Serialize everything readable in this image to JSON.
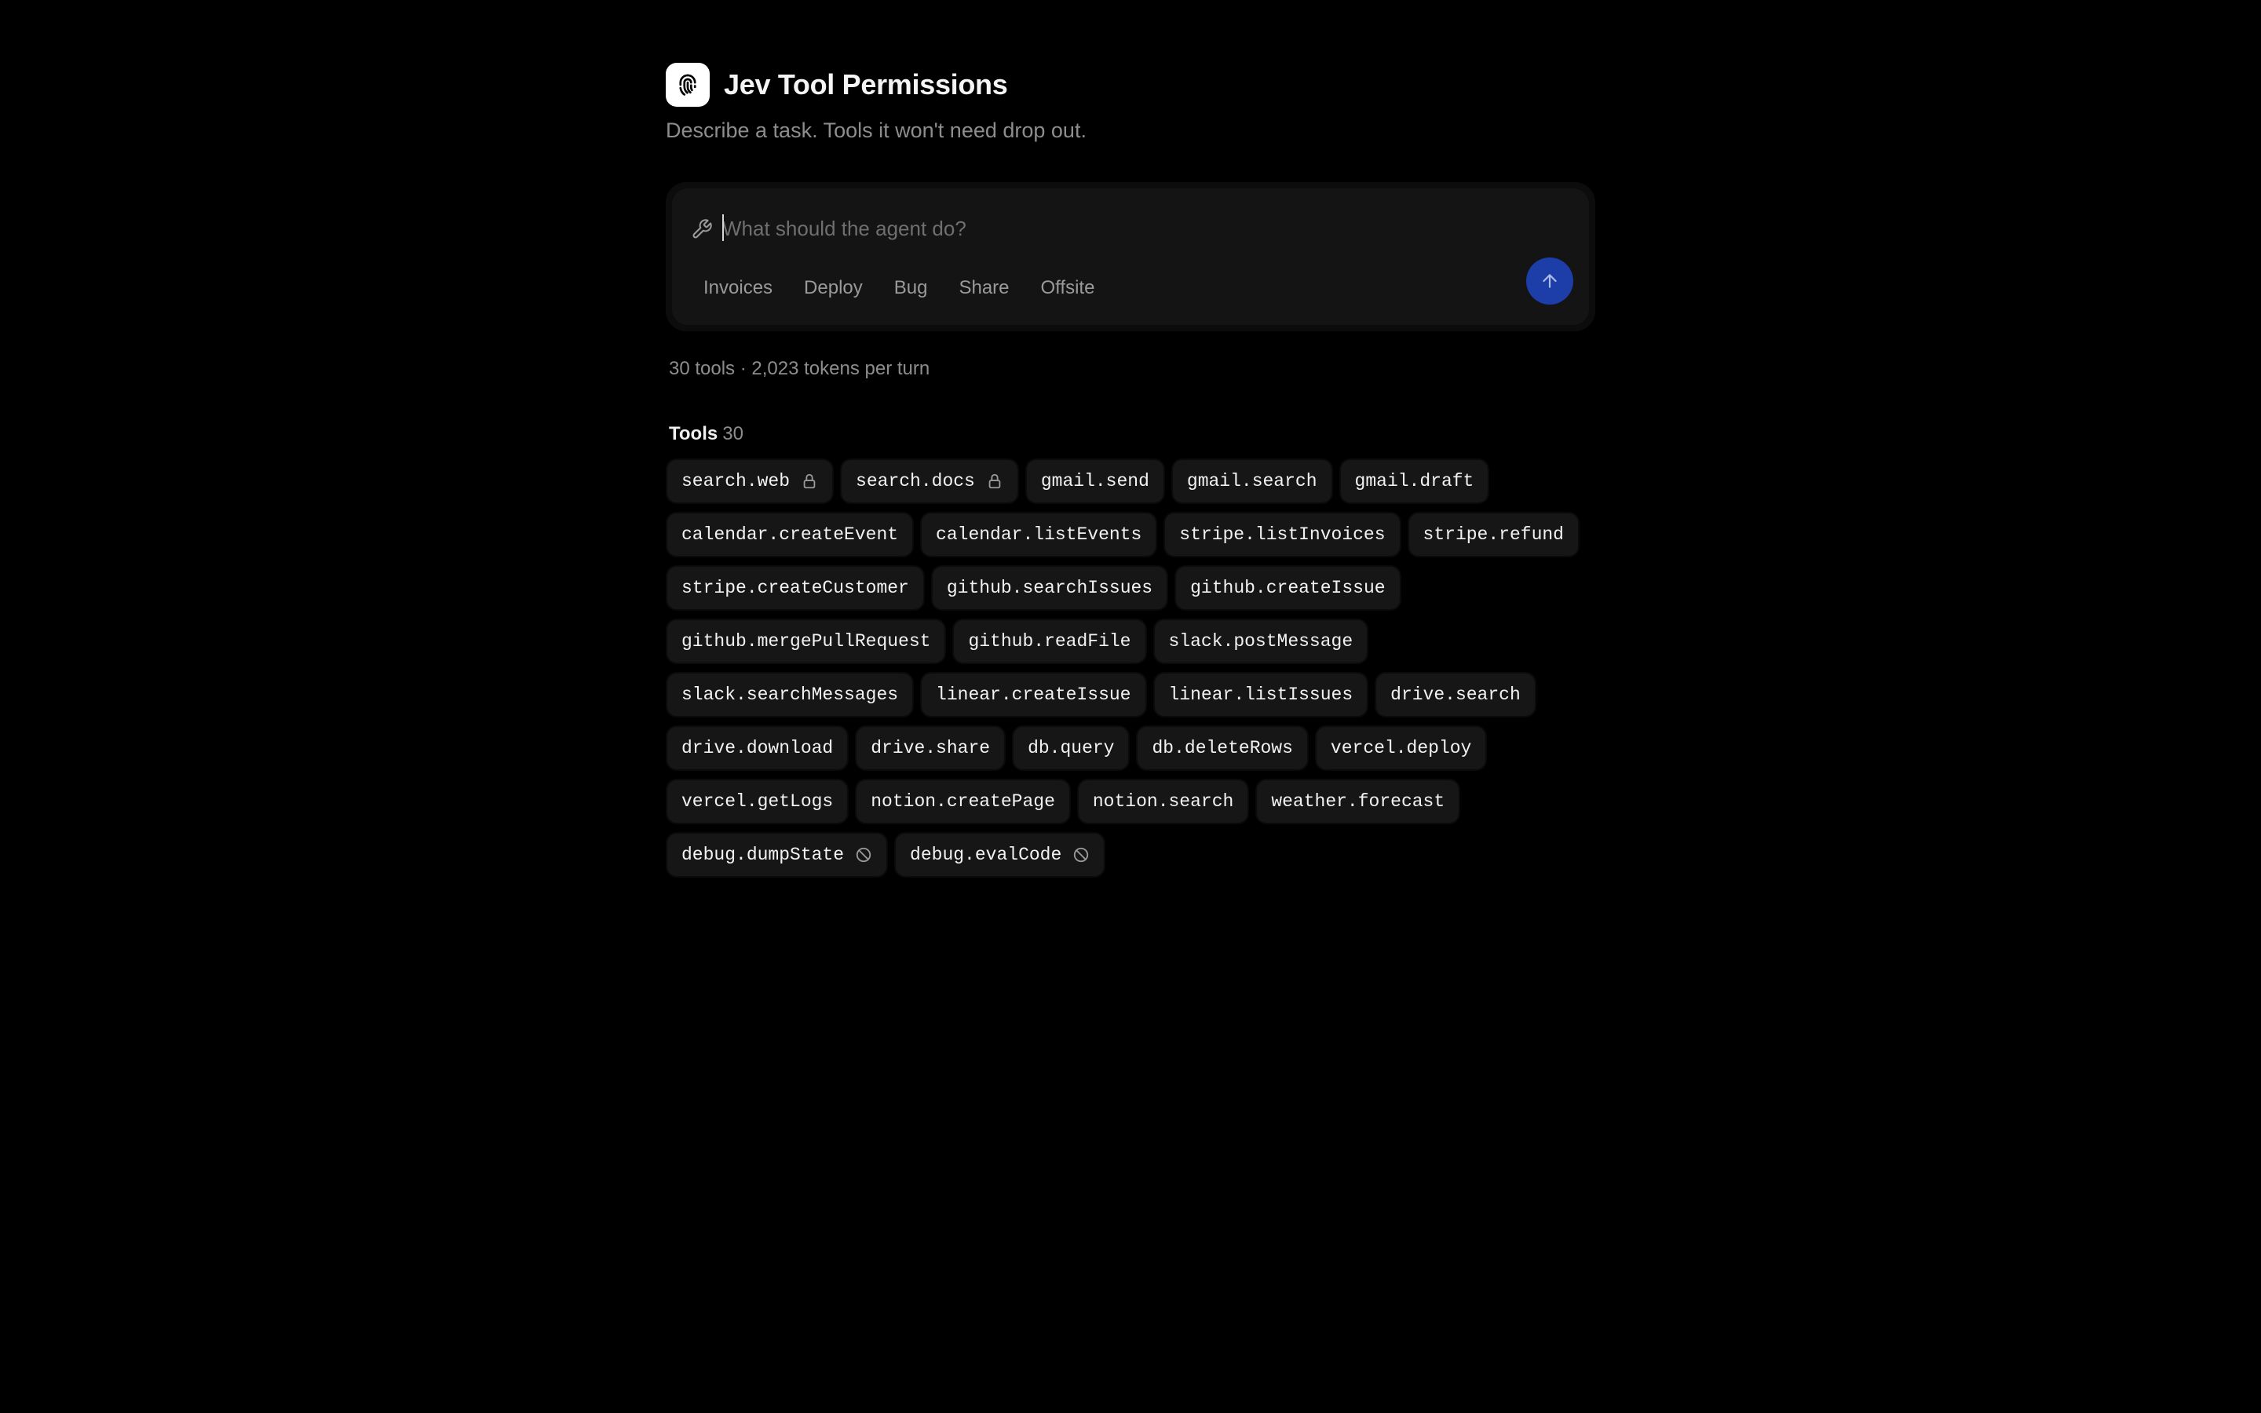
{
  "header": {
    "logo_icon": "fingerprint-icon",
    "title": "Jev Tool Permissions",
    "subtitle": "Describe a task. Tools it won't need drop out."
  },
  "composer": {
    "leading_icon": "wrench-icon",
    "placeholder": "What should the agent do?",
    "value": "",
    "suggestions": [
      "Invoices",
      "Deploy",
      "Bug",
      "Share",
      "Offsite"
    ],
    "send_icon": "arrow-up-icon",
    "send_color": "#1d3da8"
  },
  "stats": {
    "text": "30 tools · 2,023 tokens per turn"
  },
  "tools": {
    "label": "Tools",
    "count": "30",
    "items": [
      {
        "name": "search.web",
        "icon": "lock-icon"
      },
      {
        "name": "search.docs",
        "icon": "lock-icon"
      },
      {
        "name": "gmail.send",
        "icon": ""
      },
      {
        "name": "gmail.search",
        "icon": ""
      },
      {
        "name": "gmail.draft",
        "icon": ""
      },
      {
        "name": "calendar.createEvent",
        "icon": ""
      },
      {
        "name": "calendar.listEvents",
        "icon": ""
      },
      {
        "name": "stripe.listInvoices",
        "icon": ""
      },
      {
        "name": "stripe.refund",
        "icon": ""
      },
      {
        "name": "stripe.createCustomer",
        "icon": ""
      },
      {
        "name": "github.searchIssues",
        "icon": ""
      },
      {
        "name": "github.createIssue",
        "icon": ""
      },
      {
        "name": "github.mergePullRequest",
        "icon": ""
      },
      {
        "name": "github.readFile",
        "icon": ""
      },
      {
        "name": "slack.postMessage",
        "icon": ""
      },
      {
        "name": "slack.searchMessages",
        "icon": ""
      },
      {
        "name": "linear.createIssue",
        "icon": ""
      },
      {
        "name": "linear.listIssues",
        "icon": ""
      },
      {
        "name": "drive.search",
        "icon": ""
      },
      {
        "name": "drive.download",
        "icon": ""
      },
      {
        "name": "drive.share",
        "icon": ""
      },
      {
        "name": "db.query",
        "icon": ""
      },
      {
        "name": "db.deleteRows",
        "icon": ""
      },
      {
        "name": "vercel.deploy",
        "icon": ""
      },
      {
        "name": "vercel.getLogs",
        "icon": ""
      },
      {
        "name": "notion.createPage",
        "icon": ""
      },
      {
        "name": "notion.search",
        "icon": ""
      },
      {
        "name": "weather.forecast",
        "icon": ""
      },
      {
        "name": "debug.dumpState",
        "icon": "blocked-icon"
      },
      {
        "name": "debug.evalCode",
        "icon": "blocked-icon"
      }
    ]
  }
}
